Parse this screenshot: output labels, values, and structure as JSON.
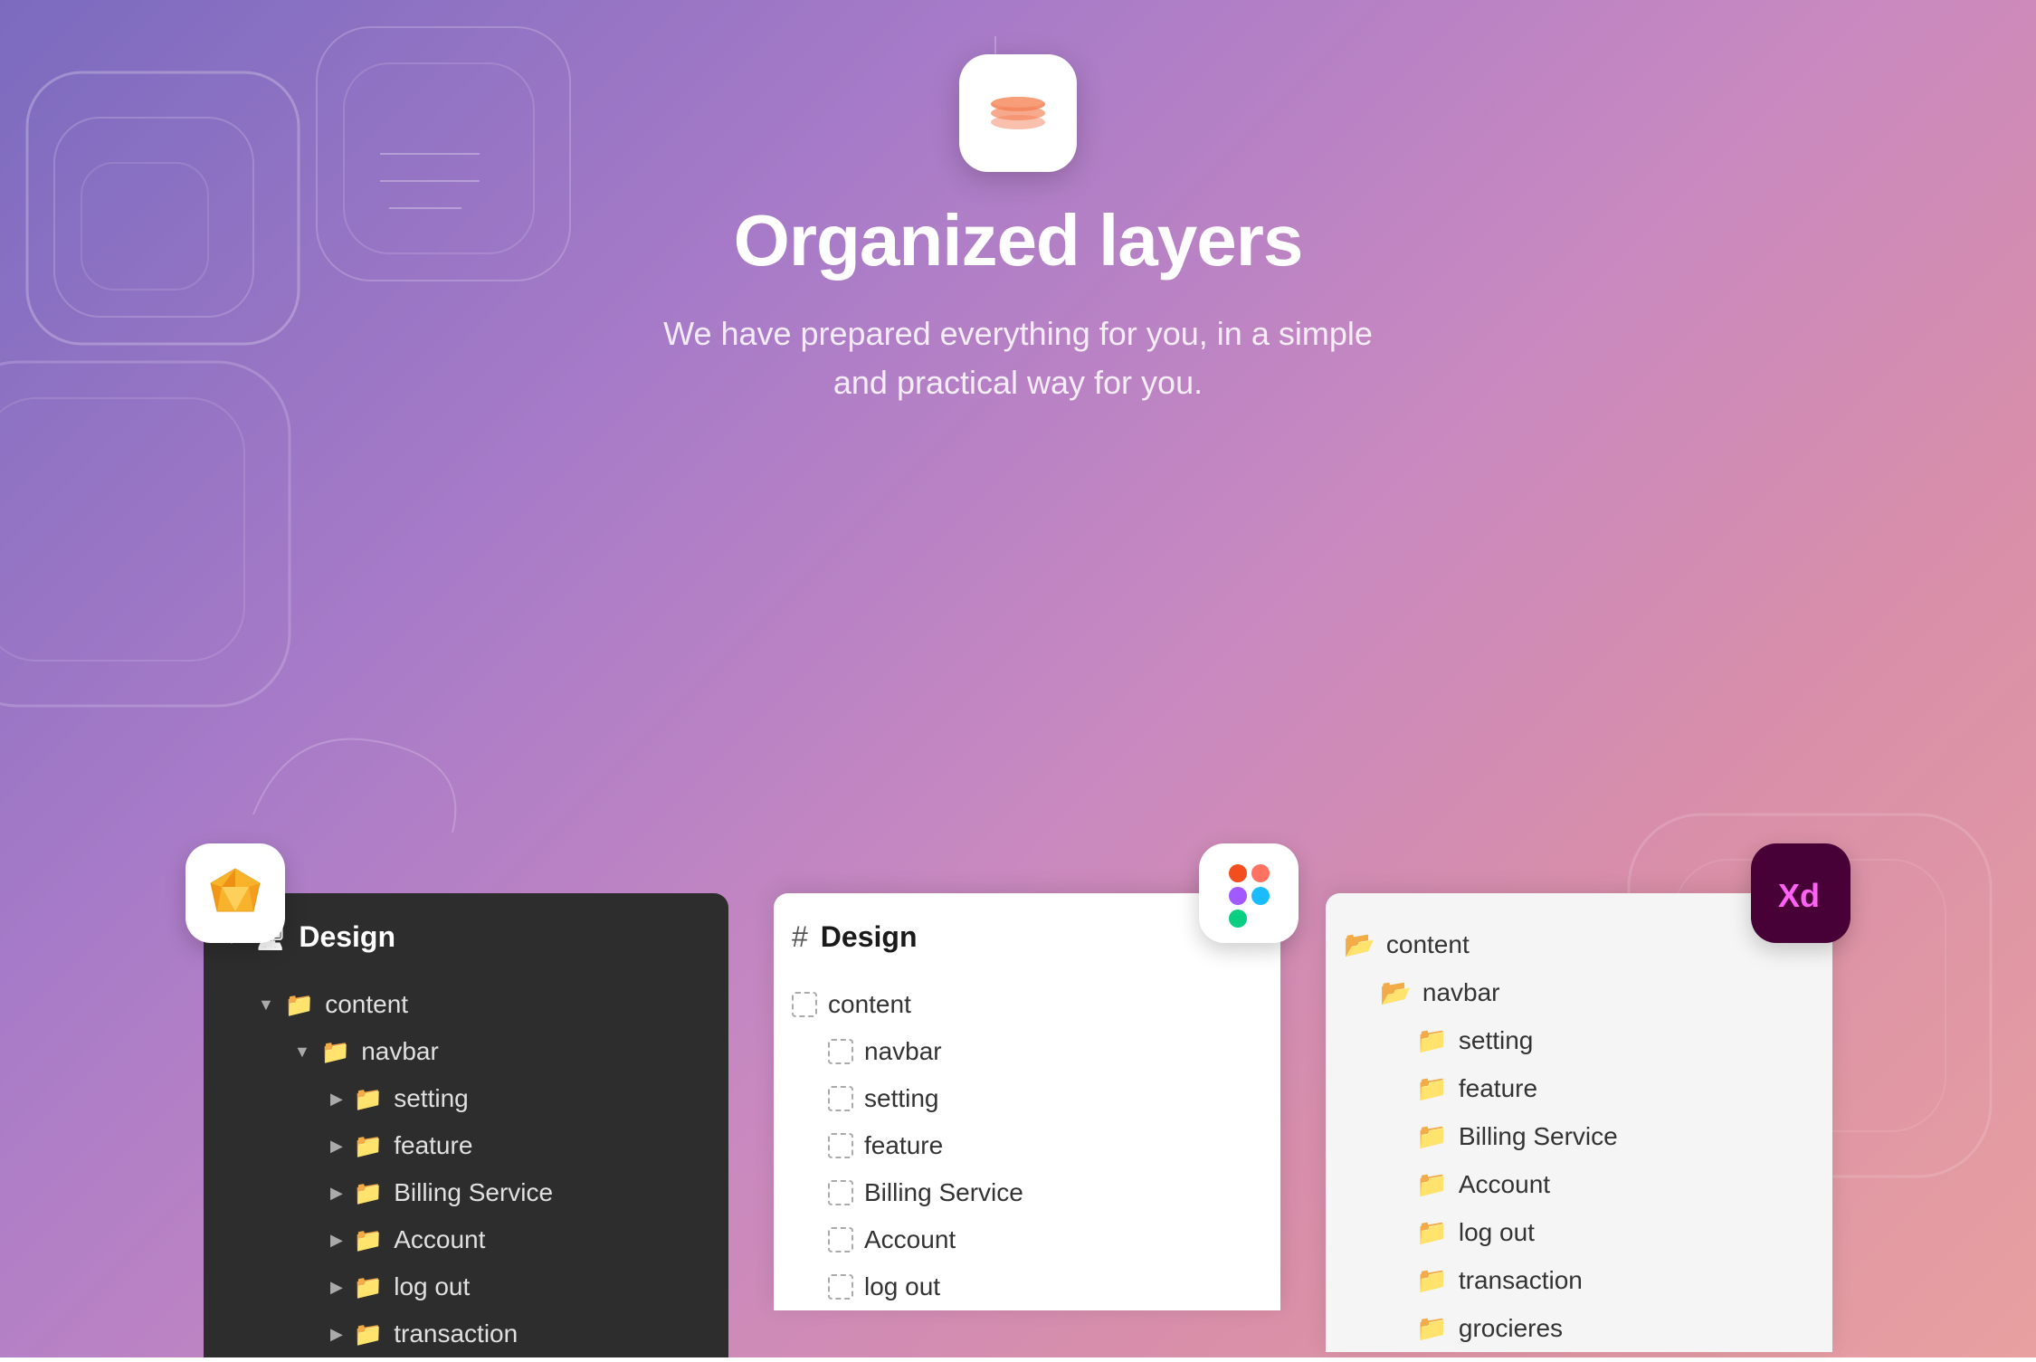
{
  "hero": {
    "title": "Organized layers",
    "subtitle": "We have prepared everything for you, in a simple\nand practical way for you.",
    "app_icon_alt": "Layers app icon"
  },
  "panels": {
    "sketch": {
      "app_name": "Sketch",
      "header": "Design",
      "items": [
        {
          "label": "content",
          "level": 1,
          "type": "folder-open",
          "caret": "down"
        },
        {
          "label": "navbar",
          "level": 2,
          "type": "folder-open",
          "caret": "down"
        },
        {
          "label": "setting",
          "level": 3,
          "type": "folder",
          "caret": "right"
        },
        {
          "label": "feature",
          "level": 3,
          "type": "folder",
          "caret": "right"
        },
        {
          "label": "Billing Service",
          "level": 3,
          "type": "folder",
          "caret": "right"
        },
        {
          "label": "Account",
          "level": 3,
          "type": "folder",
          "caret": "right"
        },
        {
          "label": "log out",
          "level": 3,
          "type": "folder",
          "caret": "right"
        },
        {
          "label": "transaction",
          "level": 3,
          "type": "folder",
          "caret": "right"
        }
      ]
    },
    "figma": {
      "app_name": "Figma",
      "header": "Design",
      "items": [
        {
          "label": "content",
          "level": 1,
          "type": "dashed"
        },
        {
          "label": "navbar",
          "level": 2,
          "type": "dashed"
        },
        {
          "label": "setting",
          "level": 2,
          "type": "dashed"
        },
        {
          "label": "feature",
          "level": 2,
          "type": "dashed"
        },
        {
          "label": "Billing Service",
          "level": 2,
          "type": "dashed"
        },
        {
          "label": "Account",
          "level": 2,
          "type": "dashed"
        },
        {
          "label": "log out",
          "level": 2,
          "type": "dashed"
        }
      ]
    },
    "xd": {
      "app_name": "Adobe XD",
      "items": [
        {
          "label": "content",
          "level": 1,
          "type": "folder"
        },
        {
          "label": "navbar",
          "level": 2,
          "type": "folder"
        },
        {
          "label": "setting",
          "level": 3,
          "type": "folder"
        },
        {
          "label": "feature",
          "level": 3,
          "type": "folder"
        },
        {
          "label": "Billing Service",
          "level": 3,
          "type": "folder"
        },
        {
          "label": "Account",
          "level": 3,
          "type": "folder"
        },
        {
          "label": "log out",
          "level": 3,
          "type": "folder"
        },
        {
          "label": "transaction",
          "level": 3,
          "type": "folder"
        },
        {
          "label": "grocieres",
          "level": 3,
          "type": "folder"
        }
      ]
    }
  }
}
